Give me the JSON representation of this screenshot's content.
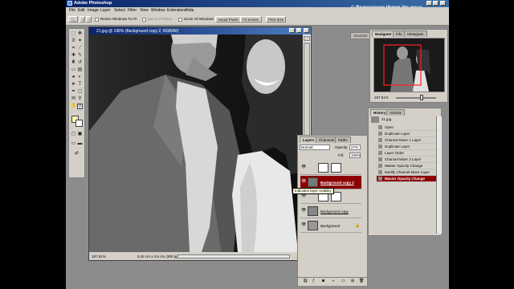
{
  "app": {
    "title": "Adobe Photoshop",
    "watermark": "© Видеоуроки Игоря Ульмана"
  },
  "menu": [
    "File",
    "Edit",
    "Image",
    "Layer",
    "Select",
    "Filter",
    "View",
    "Window",
    "Extensions",
    "Help"
  ],
  "options": {
    "resize_windows": "Resize Windows To Fit",
    "ignore_palettes": "Ignore Palettes",
    "zoom_all_windows": "Zoom All Windows",
    "actual_pixels": "Actual Pixels",
    "fit_screen": "Fit Screen",
    "print_size": "Print Size",
    "wells": [
      "Brushes",
      "Tool Presets",
      "Layer Comps"
    ]
  },
  "document": {
    "title": "21.jpg @ 198% (Background copy 2, RGB/8#)",
    "zoom": "197.51%",
    "dimensions": "5.42 cm x 3.6 cm (300 ppi)"
  },
  "navigator": {
    "tabs": [
      "Navigator",
      "Info",
      "Histogram"
    ],
    "zoom": "197.51%"
  },
  "layers": {
    "tabs": [
      "Layers",
      "Channels",
      "Paths"
    ],
    "blend_mode": "Normal",
    "opacity_label": "Opacity:",
    "opacity": "27%",
    "fill_label": "Fill:",
    "fill": "100%",
    "items": [
      {
        "name": ""
      },
      {
        "name": "Background copy 2"
      },
      {
        "name": ""
      },
      {
        "name": "Background copy"
      },
      {
        "name": "Background"
      }
    ],
    "tooltip": "Indicates layer visibility"
  },
  "history": {
    "tabs": [
      "History",
      "Actions"
    ],
    "snapshot": "21.jpg",
    "items": [
      "Open",
      "Duplicate Layer",
      "Channel Mixer 1 Layer",
      "Duplicate Layer",
      "Layer Order",
      "Channel Mixer 2 Layer",
      "Master Opacity Change",
      "Modify Channel Mixer Layer",
      "Master Opacity Change"
    ]
  },
  "colors": {
    "selection": "#8b0000",
    "titlebar": "#0a246a",
    "chrome": "#d4d0c8"
  }
}
